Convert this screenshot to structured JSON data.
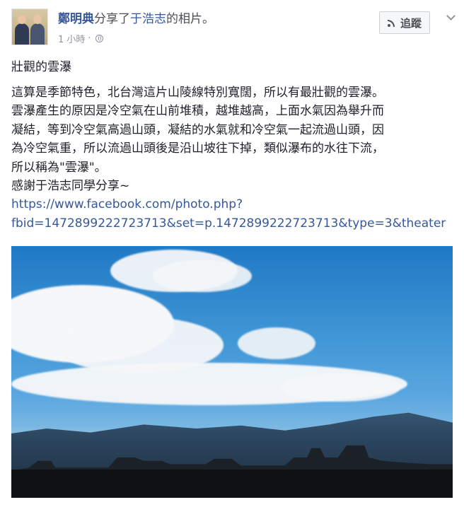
{
  "header": {
    "author_name": "鄭明典",
    "shared_text": "分享了",
    "original_owner": "于浩志",
    "shared_suffix": "的相片。",
    "timestamp": "1 小時",
    "follow_label": "追蹤"
  },
  "post": {
    "title": "壯觀的雲瀑",
    "lines": [
      "這算是季節特色，北台灣這片山陵線特別寬闊，所以有最壯觀的雲瀑。",
      "雲瀑產生的原因是冷空氣在山前堆積，越堆越高，上面水氣因為舉升而",
      "凝結，等到冷空氣高過山頭，凝結的水氣就和冷空氣一起流過山頭，因",
      "為冷空氣重，所以流過山頭後是沿山坡往下掉，類似瀑布的水往下流，",
      "所以稱為\"雲瀑\"。",
      "感謝于浩志同學分享~"
    ],
    "link_line1": "https://www.facebook.com/photo.php?",
    "link_line2": "fbid=1472899222723713&set=p.1472899222723713&type=3&theater"
  },
  "icons": {
    "privacy": "globe-icon",
    "follow": "rss-icon",
    "menu": "chevron-down-icon"
  },
  "colors": {
    "link": "#365899",
    "meta": "#90949c"
  }
}
